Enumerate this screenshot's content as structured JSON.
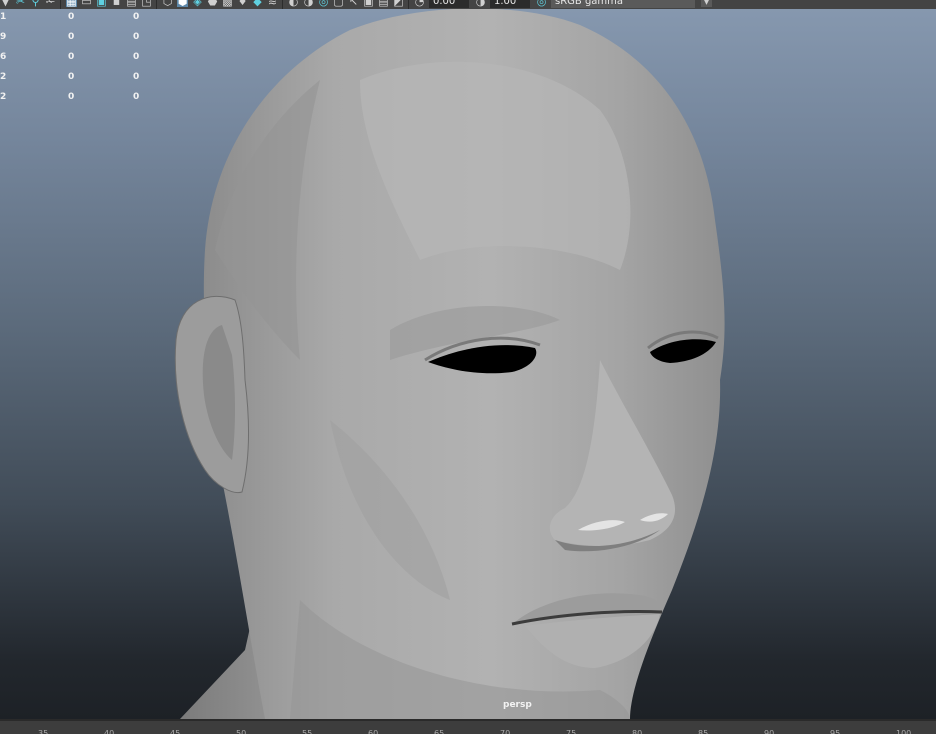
{
  "toolbar": {
    "exposure_value": "0.00",
    "gamma_value": "1.00",
    "colorspace_value": "sRGB gamma",
    "icons": [
      "camera-icon",
      "snap-icon",
      "gate-icon",
      "frame-icon",
      "grid-icon",
      "film-icon",
      "safe-icon",
      "field-icon",
      "wireframe-icon",
      "smooth-shade-icon",
      "texture-icon",
      "lights-icon",
      "shadows-icon",
      "ao-icon",
      "aa-icon",
      "dof-icon",
      "isolate-icon",
      "xray-icon",
      "joints-icon",
      "component-icon"
    ]
  },
  "hud": {
    "rows": [
      {
        "c0": "1",
        "c1": "0",
        "c2": "0"
      },
      {
        "c0": "9",
        "c1": "0",
        "c2": "0"
      },
      {
        "c0": "6",
        "c1": "0",
        "c2": "0"
      },
      {
        "c0": "2",
        "c1": "0",
        "c2": "0"
      },
      {
        "c0": "2",
        "c1": "0",
        "c2": "0"
      }
    ]
  },
  "viewport": {
    "camera_label": "persp"
  },
  "timeline": {
    "ticks": [
      "35",
      "40",
      "45",
      "50",
      "55",
      "60",
      "65",
      "70",
      "75",
      "80",
      "85",
      "90",
      "95",
      "100"
    ]
  },
  "colors": {
    "viewport_top": "#8799b0",
    "viewport_bottom": "#1d2126",
    "toolbar_bg": "#444444",
    "model": "#a8a8a8"
  }
}
